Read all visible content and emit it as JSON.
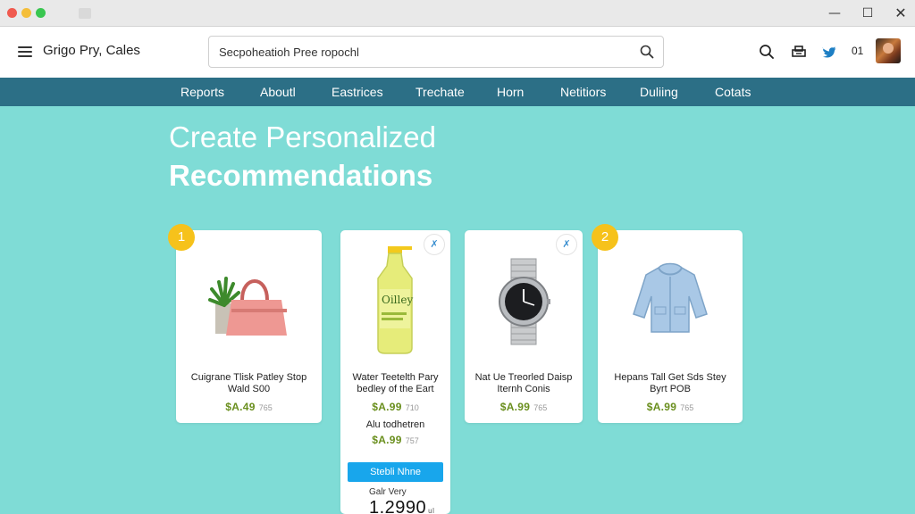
{
  "window": {
    "min": "—",
    "max": "☐",
    "close": "✕"
  },
  "header": {
    "brand": "Grigo Pry, Cales",
    "search_value": "Secpoheatioh Pree ropochl",
    "count": "01"
  },
  "nav": [
    "Reports",
    "Aboutl",
    "Eastrices",
    "Trechate",
    "Horn",
    "Netitiors",
    "Duliing",
    "Cotats"
  ],
  "hero": {
    "line1": "Create Personalized",
    "line2": "Recommendations"
  },
  "cards": [
    {
      "badge": "1",
      "title1": "Cuigrane Tlisk Patley Stop",
      "title2": "Wald S00",
      "price": "$A.49",
      "old": "765"
    },
    {
      "fav": "✗",
      "title1": "Water Teetelth Pary",
      "title2": "bedley of the Eart",
      "price": "$A.99",
      "old": "710",
      "sub_title": "Alu todhetren",
      "sub_price": "$A.99",
      "sub_old": "757",
      "cta": "Stebli Nhne",
      "small_label": "Galr Very",
      "big": "1.2990",
      "big_sup": "ul"
    },
    {
      "fav": "✗",
      "title1": "Nat Ue Treorled Daisp",
      "title2": "Iternh Conis",
      "price": "$A.99",
      "old": "765"
    },
    {
      "badge": "2",
      "title1": "Hepans Tall Get Sds Stey",
      "title2": "Byrt POB",
      "price": "$A.99",
      "old": "765"
    }
  ],
  "colors": {
    "background": "#7fdcd6",
    "nav": "#2c6f86",
    "badge": "#f6c21b",
    "cta": "#18a6ec",
    "price": "#6a8f1e"
  },
  "icons": [
    "menu-icon",
    "search-icon",
    "print-icon",
    "twitter-icon",
    "avatar"
  ]
}
